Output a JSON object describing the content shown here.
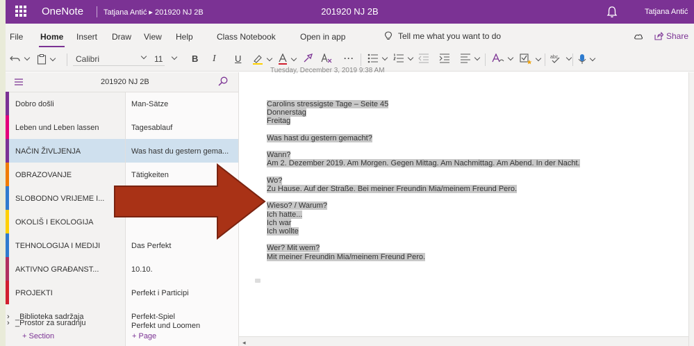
{
  "titlebar": {
    "app_name": "OneNote",
    "breadcrumb": "Tatjana Antić ▸ 201920 NJ 2B",
    "doc_title": "201920 NJ 2B",
    "user": "Tatjana Antić"
  },
  "tabs": {
    "items": [
      "File",
      "Home",
      "Insert",
      "Draw",
      "View",
      "Help",
      "Class Notebook",
      "Open in app"
    ],
    "active": "Home",
    "tell_me": "Tell me what you want to do",
    "share": "Share"
  },
  "ribbon": {
    "font": "Calibri",
    "size": "11",
    "bold": "B",
    "italic": "I",
    "underline": "U"
  },
  "notebook": {
    "name": "201920 NJ 2B",
    "add_section": "+ Section",
    "add_page": "+ Page"
  },
  "sections": [
    {
      "label": "Dobro došli",
      "color": "#7b3294"
    },
    {
      "label": "Leben und Leben lassen",
      "color": "#e3007b"
    },
    {
      "label": "NAČIN ŽIVLJENJA",
      "color": "#7b3294",
      "selected": true
    },
    {
      "label": "OBRAZOVANJE",
      "color": "#f07c00"
    },
    {
      "label": "SLOBODNO VRIJEME I...",
      "color": "#2e7bcf"
    },
    {
      "label": "OKOLIŠ I EKOLOGIJA",
      "color": "#ffd000"
    },
    {
      "label": "TEHNOLOGIJA I MEDIJI",
      "color": "#2e7bcf"
    },
    {
      "label": "AKTIVNO GRAĐANST...",
      "color": "#b03060"
    },
    {
      "label": "PROJEKTI",
      "color": "#d11f2f"
    },
    {
      "label": "_Biblioteka sadržaja",
      "color": "",
      "group": true
    },
    {
      "label": "_Prostor za suradnju",
      "color": "",
      "group": true
    }
  ],
  "pages": [
    {
      "label": "Man-Sätze"
    },
    {
      "label": "Tagesablauf"
    },
    {
      "label": "Was hast du gestern gema...",
      "selected": true
    },
    {
      "label": "Tätigkeiten"
    },
    {
      "label": ""
    },
    {
      "label": ""
    },
    {
      "label": "Das Perfekt"
    },
    {
      "label": "10.10."
    },
    {
      "label": "Perfekt i Participi"
    },
    {
      "label": "Perfekt-Spiel"
    },
    {
      "label": "Perfekt und Loomen"
    }
  ],
  "canvas": {
    "date_cut": "Tuesday, December 3, 2019    9:38 AM",
    "lines": [
      "Carolins stressigste Tage – Seite 45",
      "Donnerstag",
      "Freitag",
      "",
      "Was hast du gestern gemacht?",
      "",
      "Wann?",
      "Am 2. Dezember 2019. Am Morgen. Gegen Mittag. Am Nachmittag. Am Abend. In der Nacht.",
      "",
      "Wo?",
      "Zu Hause. Auf der Straße. Bei meiner Freundin Mia/meinem Freund Pero.",
      "",
      "Wieso? / Warum?",
      "Ich hatte...",
      "Ich war",
      "Ich wollte",
      "",
      "Wer? Mit wem?",
      "Mit meiner Freundin Mia/meinem Freund Pero."
    ]
  },
  "colors": {
    "accent": "#7b3294",
    "selection": "#cfe0ee",
    "arrow_fill": "#a93216",
    "arrow_stroke": "#7a2310"
  }
}
